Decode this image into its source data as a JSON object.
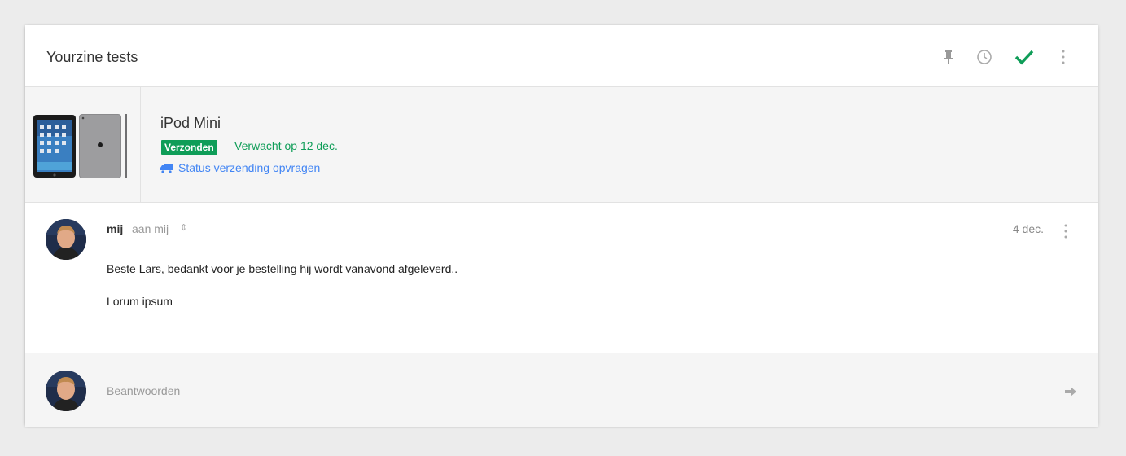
{
  "thread": {
    "title": "Yourzine tests",
    "toolbar_icons": [
      "pin-icon",
      "clock-icon",
      "check-icon",
      "more-vert-icon"
    ]
  },
  "product": {
    "name": "iPod Mini",
    "status_badge": "Verzonden",
    "expected_text": "Verwacht op 12 dec.",
    "track_link": "Status verzending opvragen"
  },
  "message": {
    "sender": "mij",
    "recipient": "aan mij",
    "date": "4 dec.",
    "lines": [
      "Beste Lars, bedankt voor je bestelling hij wordt vanavond afgeleverd..",
      "Lorum ipsum"
    ]
  },
  "reply": {
    "label": "Beantwoorden"
  },
  "colors": {
    "accent_green": "#0f9d58",
    "link_blue": "#4285f4"
  }
}
